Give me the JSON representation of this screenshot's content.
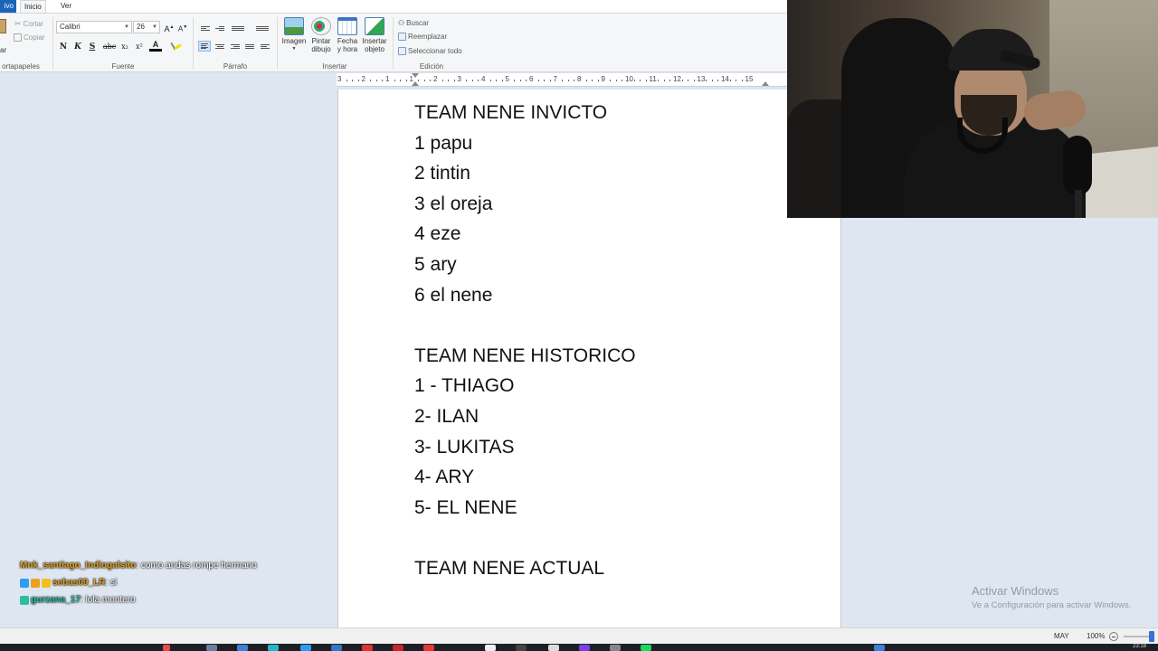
{
  "menu": {
    "file": "ivo",
    "inicio": "Inicio",
    "ver": "Ver"
  },
  "ribbon": {
    "portapapeles": {
      "label": "ortapapeles",
      "paste": "ar",
      "cut": "Cortar",
      "copy": "Copiar"
    },
    "fuente": {
      "label": "Fuente",
      "font_name": "Calibri",
      "font_size": "26",
      "bold": "N",
      "italic": "K",
      "underline": "S",
      "strike": "abc",
      "sub": "x₂",
      "sup": "x²",
      "color": "A"
    },
    "parrafo": {
      "label": "Párrafo"
    },
    "insertar": {
      "label": "Insertar",
      "image": "Imagen",
      "paint_1": "Pintar",
      "paint_2": "dibujo",
      "date_1": "Fecha",
      "date_2": "y hora",
      "obj_1": "Insertar",
      "obj_2": "objeto"
    },
    "edicion": {
      "label": "Edición",
      "find": "Buscar",
      "replace": "Reemplazar",
      "select_all": "Seleccionar todo"
    }
  },
  "ruler": {
    "ticks": [
      "3",
      "2",
      "1",
      "1",
      "2",
      "3",
      "4",
      "5",
      "6",
      "7",
      "8",
      "9",
      "10",
      "11",
      "12",
      "13",
      "14",
      "15"
    ]
  },
  "document": {
    "lines": [
      "TEAM NENE INVICTO",
      "1 papu",
      "2 tintin",
      "3 el oreja",
      "4 eze",
      "5 ary",
      "6 el nene",
      "",
      "TEAM NENE HISTORICO",
      "1 - THIAGO",
      "2- ILAN",
      "3- LUKITAS",
      "4- ARY",
      "5- EL NENE",
      "",
      "TEAM NENE ACTUAL"
    ]
  },
  "chat": [
    {
      "user": "Mnk_santiago_Indiogalsito",
      "text": " : como andas rompe hermano",
      "color": "#e0a020"
    },
    {
      "user": "sebas09_LR",
      "text": " : si",
      "color": "#e0a020"
    },
    {
      "user": "gurzana_17",
      "text": " : lola montero",
      "color": "#2bbfa0"
    }
  ],
  "watermark": {
    "title": "Activar Windows",
    "subtitle": "Ve a Configuración para activar Windows."
  },
  "status": {
    "caps": "MAY",
    "zoom": "100%"
  },
  "taskbar": {
    "clock": "23:18"
  }
}
